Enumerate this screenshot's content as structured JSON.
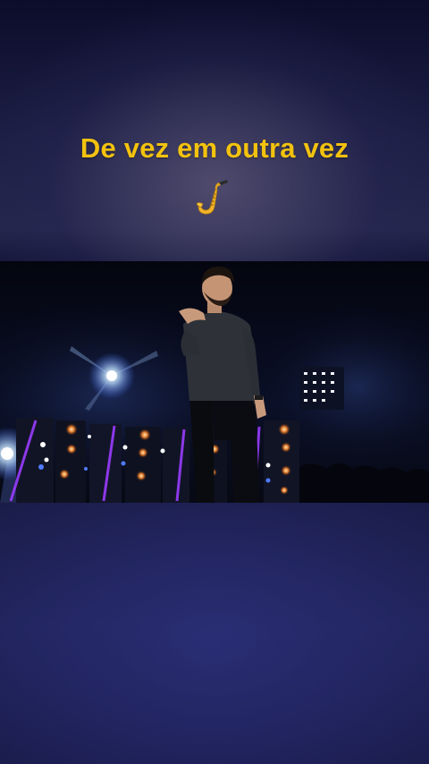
{
  "caption": {
    "text": "De vez em outra vez",
    "icon": "saxophone-icon"
  },
  "colors": {
    "caption_text": "#f2c20f",
    "background_top": "#0c0d2a",
    "background_bottom": "#1a1c4c",
    "stage_light": "#ffffff",
    "stage_accent": "#8b2cff"
  }
}
